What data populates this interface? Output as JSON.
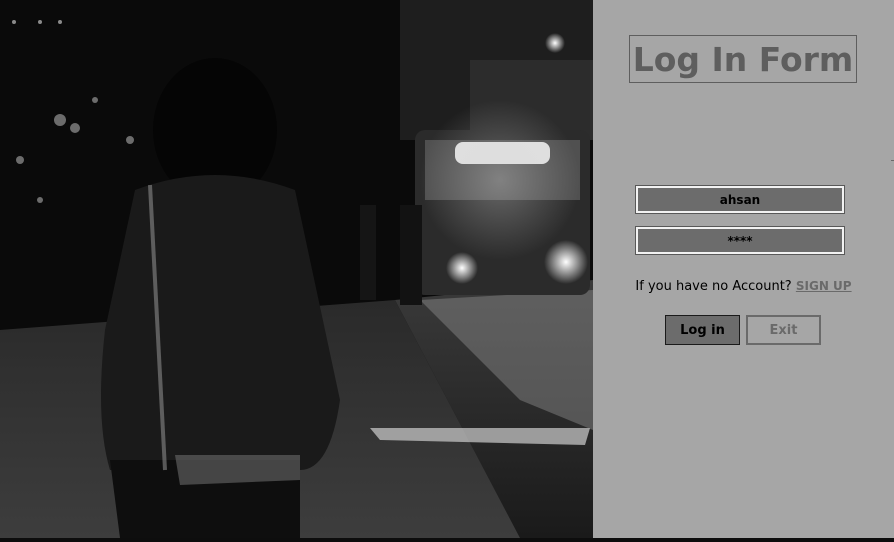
{
  "form": {
    "title": "Log In Form",
    "username_value": "ahsan",
    "password_value": "****",
    "signup_prompt": "If you have no Account?",
    "signup_link": "SIGN UP",
    "login_label": "Log in",
    "exit_label": "Exit"
  },
  "background": {
    "photo_description_icon": "night-street-photo"
  },
  "colors": {
    "panel": "#a6a6a6",
    "field": "#6c6c6c",
    "title": "#5e5e5e"
  }
}
